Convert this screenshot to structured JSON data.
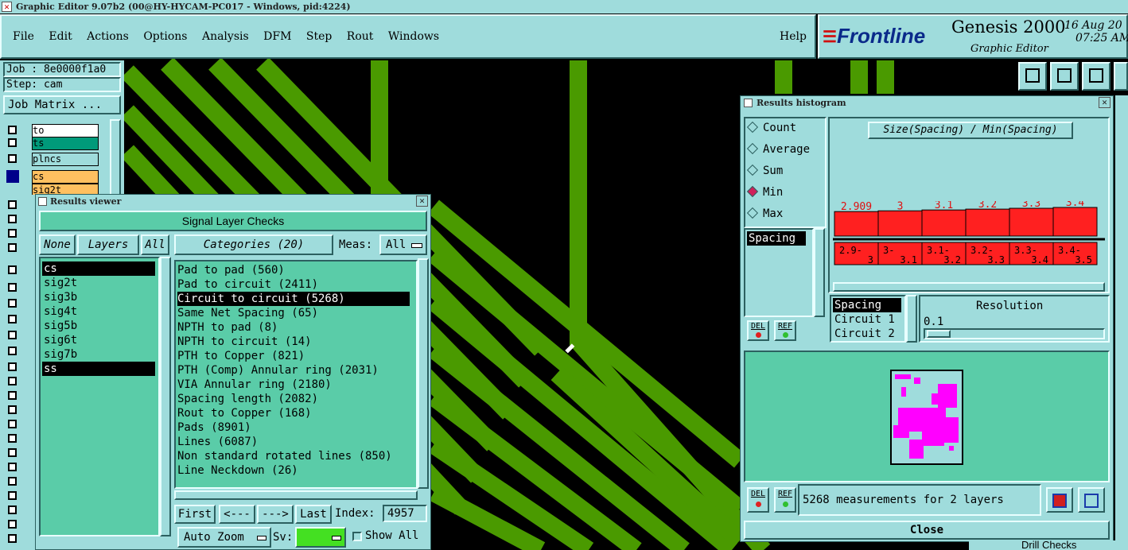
{
  "app": {
    "window_title": "Graphic Editor 9.07b2 (00@HY-HYCAM-PC017 - Windows, pid:4224)",
    "brand": "Frontline",
    "product": "Genesis 2000",
    "subtitle": "Graphic Editor",
    "date": "16 Aug 20",
    "time": "07:25 AM"
  },
  "menu": {
    "items": [
      "File",
      "Edit",
      "Actions",
      "Options",
      "Analysis",
      "DFM",
      "Step",
      "Rout",
      "Windows"
    ],
    "help": "Help"
  },
  "left_panel": {
    "job": "Job : 8e0000f1a0",
    "step": "Step: cam",
    "job_matrix": "Job Matrix ...",
    "layers": [
      {
        "name": "to",
        "color": "#ffffff"
      },
      {
        "name": "ts",
        "color": "#009a7a"
      },
      {
        "name": "plncs",
        "color": "#9fdcdc"
      },
      {
        "name": "cs",
        "color": "#ffc060"
      },
      {
        "name": "sig2t",
        "color": "#ffc060"
      }
    ]
  },
  "results_viewer": {
    "title": "Results viewer",
    "header": "Signal Layer Checks",
    "none_btn": "None",
    "layers_label": "Layers",
    "all_btn": "All",
    "categories_label": "Categories (20)",
    "meas_label": "Meas:",
    "meas_value": "All",
    "layers": [
      "cs",
      "sig2t",
      "sig3b",
      "sig4t",
      "sig5b",
      "sig6t",
      "sig7b",
      "ss"
    ],
    "categories": [
      "Pad to pad (560)",
      "Pad to circuit (2411)",
      "Circuit to circuit (5268)",
      "Same Net Spacing (65)",
      "NPTH to pad (8)",
      "NPTH to circuit (14)",
      "PTH to Copper (821)",
      "PTH (Comp) Annular ring (2031)",
      "VIA Annular ring (2180)",
      "Spacing length (2082)",
      "Rout to Copper (168)",
      "Pads (8901)",
      "Lines (6087)",
      "Non standard rotated lines (850)",
      "Line Neckdown (26)"
    ],
    "first_btn": "First",
    "prev_btn": "<---",
    "next_btn": "--->",
    "last_btn": "Last",
    "index_label": "Index:",
    "index_value": "4957",
    "auto_zoom": "Auto Zoom",
    "sv_label": "Sv:",
    "show_all": "Show All"
  },
  "histogram": {
    "title": "Results histogram",
    "modes": [
      "Count",
      "Average",
      "Sum",
      "Min",
      "Max"
    ],
    "selected_mode": "Min",
    "measure_list": [
      "Spacing"
    ],
    "del_btn": "DEL",
    "ref_btn": "REF",
    "chart_title": "Size(Spacing) / Min(Spacing)",
    "fields": [
      "Spacing",
      "Circuit 1",
      "Circuit 2"
    ],
    "resolution_label": "Resolution",
    "resolution_value": "0.1",
    "status": "5268 measurements for 2 layers",
    "close_btn": "Close",
    "bar_color": "#ff2020"
  },
  "chart_data": {
    "type": "bar",
    "title": "Size(Spacing) / Min(Spacing)",
    "categories": [
      "2.9-3",
      "3-3.1",
      "3.1-3.2",
      "3.2-3.3",
      "3.3-3.4",
      "3.4-3.5"
    ],
    "category_labels": [
      [
        "2.9-",
        "3"
      ],
      [
        "3-",
        "3.1"
      ],
      [
        "3.1-",
        "3.2"
      ],
      [
        "3.2-",
        "3.3"
      ],
      [
        "3.3-",
        "3.4"
      ],
      [
        "3.4-",
        "3.5"
      ]
    ],
    "values": [
      2.909,
      3,
      3.1,
      3.2,
      3.3,
      3.4
    ],
    "value_labels": [
      "2.909",
      "3",
      "3.1",
      "3.2",
      "3.3",
      "3.4"
    ],
    "ylim": [
      0,
      3.4
    ]
  },
  "background": {
    "partial_label": "Drill Checks"
  }
}
